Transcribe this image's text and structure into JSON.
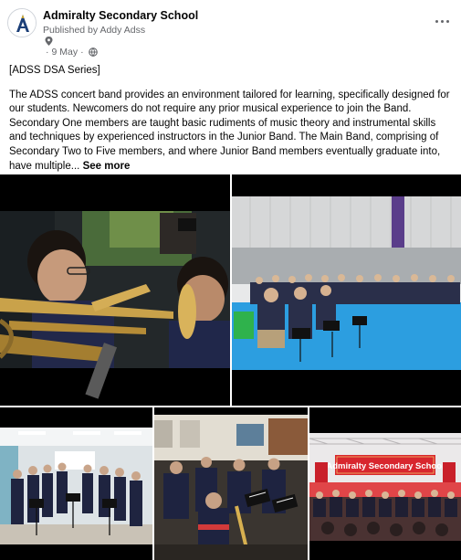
{
  "post": {
    "page_name": "Admiralty Secondary School",
    "publisher_line": "Published by Addy Adss",
    "date": "9 May",
    "dot": "·",
    "location_icon": "location-pin-icon",
    "audience_icon": "globe-icon",
    "more_icon": "more-options-icon",
    "heading": "[ADSS DSA Series]",
    "body": "The ADSS concert band provides an environment tailored for learning, specifically designed for our students. Newcomers do not require any prior musical experience to join the Band. Secondary One members are taught basic rudiments of music theory and instrumental skills and techniques by experienced instructors in the Junior Band. The Main Band, comprising of Secondary Two to Five members, and where Junior Band members eventually graduate into, have multiple...",
    "see_more": "See more"
  },
  "photos": {
    "banner_text": "Admiralty Secondary School"
  },
  "colors": {
    "text_primary": "#050505",
    "text_secondary": "#65676b",
    "stage_blue": "#2c9ee0",
    "banner_red": "#d8262e",
    "chair_green": "#2fb24c"
  }
}
